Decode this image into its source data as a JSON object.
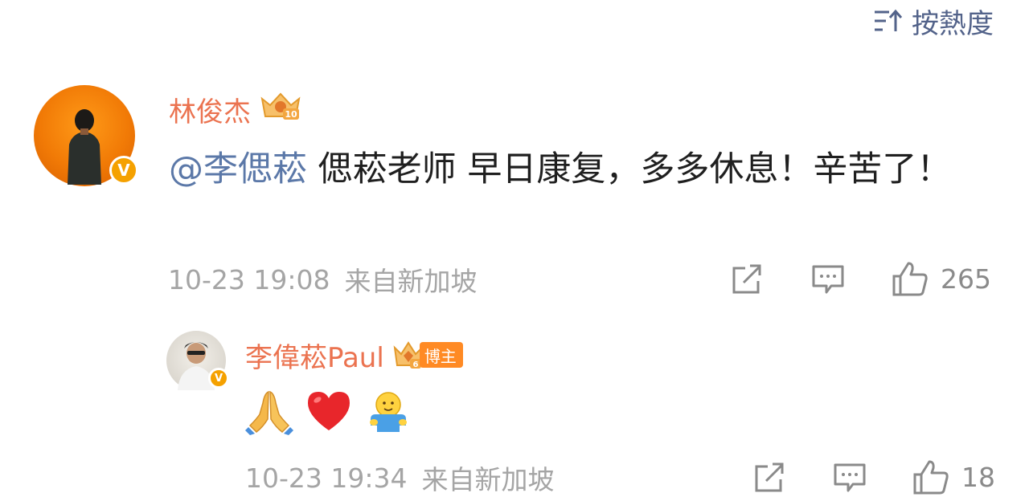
{
  "sort": {
    "label": "按熱度",
    "icon": "sort-icon"
  },
  "comments": [
    {
      "author": "林俊杰",
      "level_badge": "10",
      "verified_badge": "V",
      "mention": "@李偲菘",
      "text": " 偲菘老师 早日康复，多多休息！辛苦了！",
      "time": "10-23 19:08",
      "source": "来自新加坡",
      "likes": "265"
    },
    {
      "author": "李偉菘Paul",
      "level_badge": "6",
      "role_badge": "博主",
      "verified_badge": "V",
      "emojis": [
        "folded-hands",
        "red-heart",
        "hug"
      ],
      "time": "10-23 19:34",
      "source": "来自新加坡",
      "likes": "18"
    }
  ],
  "colors": {
    "name": "#eb7350",
    "mention": "#5b78a8",
    "meta": "#a5a5a5",
    "icon": "#8a8a8a",
    "badge_orange": "#ff8a24",
    "verified": "#f5a100"
  }
}
